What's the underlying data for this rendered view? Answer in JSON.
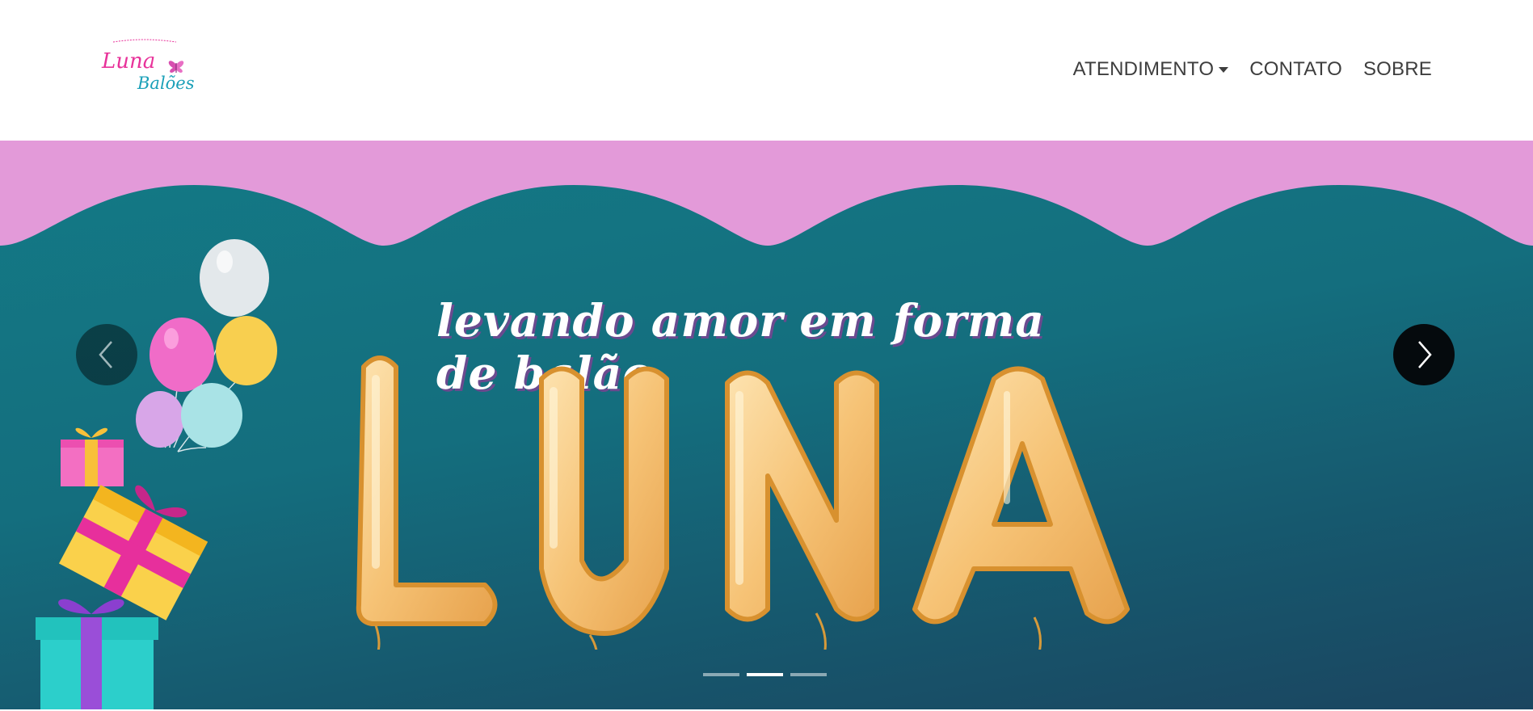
{
  "brand": {
    "name_line1": "Luna",
    "name_line2": "Balões",
    "tagline_small": "levando amor em forma de balão",
    "colors": {
      "pink": "#e8329a",
      "teal": "#1aa0b8",
      "butterfly": "#d84fb0"
    }
  },
  "nav": {
    "items": [
      {
        "label": "ATENDIMENTO",
        "dropdown": true
      },
      {
        "label": "CONTATO",
        "dropdown": false
      },
      {
        "label": "SOBRE",
        "dropdown": false
      }
    ]
  },
  "carousel": {
    "slide": {
      "tagline": "levando amor em forma de balão",
      "hero_word": "LUNA",
      "colors": {
        "background": "#137a86",
        "scallop": "#e39ad9",
        "balloon_letters": "#f3bd6b"
      }
    },
    "controls": {
      "prev_icon": "chevron-left-icon",
      "next_icon": "chevron-right-icon"
    },
    "indicators": {
      "count": 3,
      "active_index": 1
    }
  }
}
